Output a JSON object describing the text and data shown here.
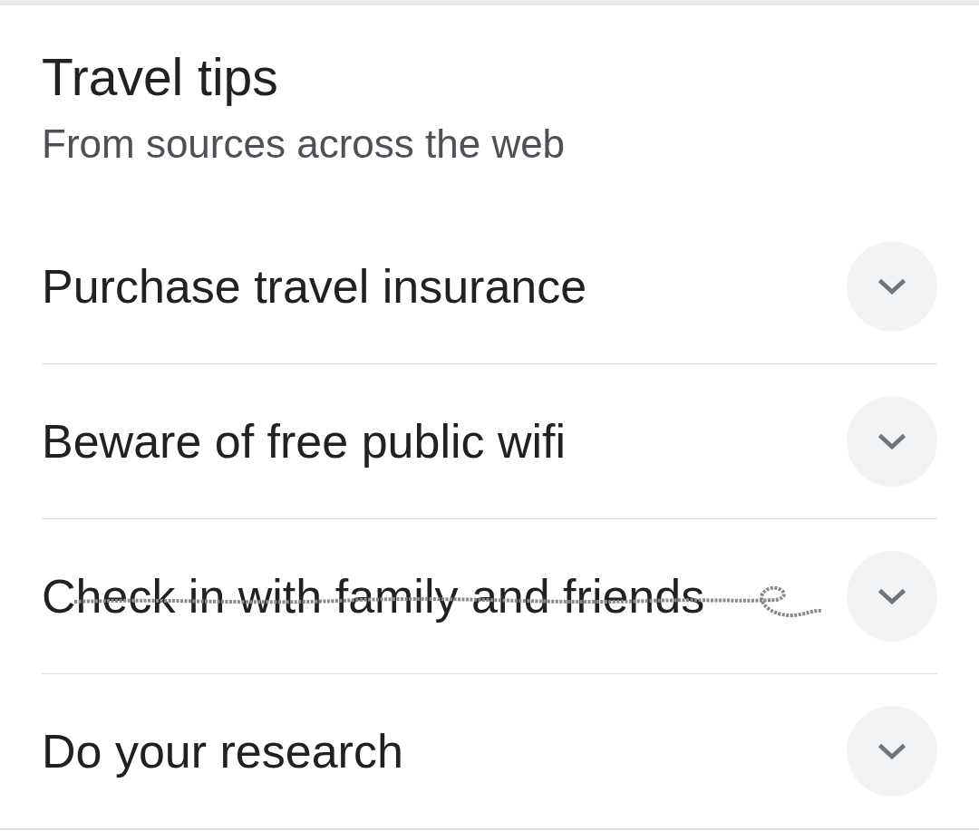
{
  "header": {
    "title": "Travel tips",
    "subtitle": "From sources across the web"
  },
  "tips": [
    {
      "label": "Purchase travel insurance",
      "expanded": false,
      "scribbled": false
    },
    {
      "label": "Beware of free public wifi",
      "expanded": false,
      "scribbled": false
    },
    {
      "label": "Check in with family and friends",
      "expanded": false,
      "scribbled": true
    },
    {
      "label": "Do your research",
      "expanded": false,
      "scribbled": false
    }
  ]
}
